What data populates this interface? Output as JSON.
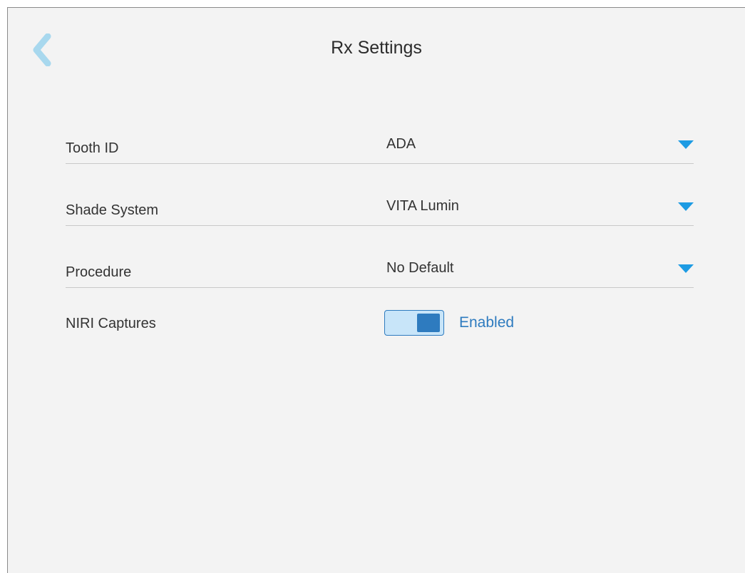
{
  "header": {
    "title": "Rx Settings",
    "back_icon": "chevron-left-icon"
  },
  "settings": [
    {
      "label": "Tooth ID",
      "value": "ADA",
      "control": "dropdown"
    },
    {
      "label": "Shade System",
      "value": "VITA Lumin",
      "control": "dropdown"
    },
    {
      "label": "Procedure",
      "value": "No Default",
      "control": "dropdown"
    }
  ],
  "niri": {
    "label": "NIRI Captures",
    "enabled": true,
    "status": "Enabled"
  },
  "colors": {
    "accent": "#2e7bbf",
    "caret": "#1d9be3",
    "back_chevron": "#a8d8ee",
    "toggle_track": "#c8e5f9",
    "background": "#f3f3f3"
  }
}
